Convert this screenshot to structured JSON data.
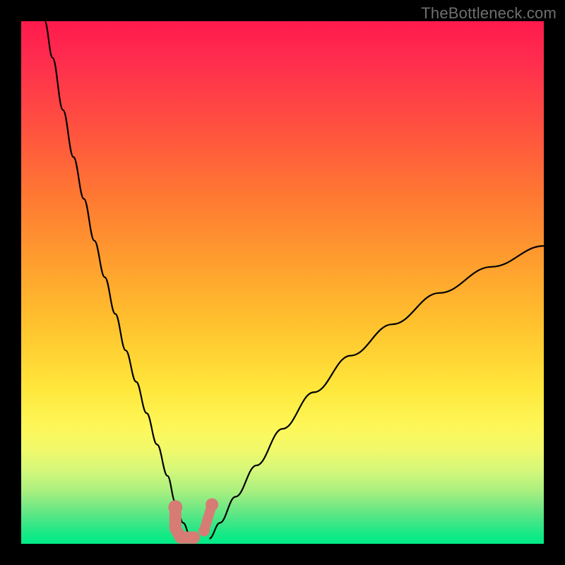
{
  "watermark": "TheBottleneck.com",
  "chart_data": {
    "type": "line",
    "title": "",
    "xlabel": "",
    "ylabel": "",
    "xlim": [
      0,
      100
    ],
    "ylim": [
      0,
      100
    ],
    "grid": false,
    "legend": false,
    "background_gradient": {
      "top": "#ff1a4d",
      "bottom": "#00ea87",
      "description": "vertical red-orange-yellow-green gradient"
    },
    "series": [
      {
        "name": "left-branch",
        "x": [
          4.5,
          6,
          8,
          10,
          12,
          14,
          16,
          18,
          20,
          22,
          24,
          26,
          28,
          29.5,
          31,
          32.5
        ],
        "y": [
          100,
          93,
          83,
          74,
          66,
          58,
          51,
          44,
          37,
          31,
          25,
          19,
          13,
          8,
          4,
          1
        ],
        "stroke": "#000000"
      },
      {
        "name": "right-branch",
        "x": [
          36,
          38,
          41,
          45,
          50,
          56,
          63,
          71,
          80,
          90,
          100
        ],
        "y": [
          1,
          4,
          9,
          15,
          22,
          29,
          36,
          42,
          48,
          53,
          57
        ],
        "stroke": "#000000"
      }
    ],
    "annotations": [
      {
        "kind": "marker-path",
        "description": "pink L-shaped marker cluster near curve minimum",
        "points_xy": [
          [
            29.5,
            7
          ],
          [
            29.5,
            3
          ],
          [
            30.5,
            1.2
          ],
          [
            33,
            1.2
          ],
          [
            35,
            2.5
          ],
          [
            36.5,
            7.5
          ]
        ],
        "color": "#d67c74"
      }
    ],
    "notes": "No axes, ticks, or labels visible. Black border (page background) frames a gradient plot area. Two black curve branches form a V with minimum near x≈34. A small cluster of pink rounded markers sits at/near the trough."
  }
}
